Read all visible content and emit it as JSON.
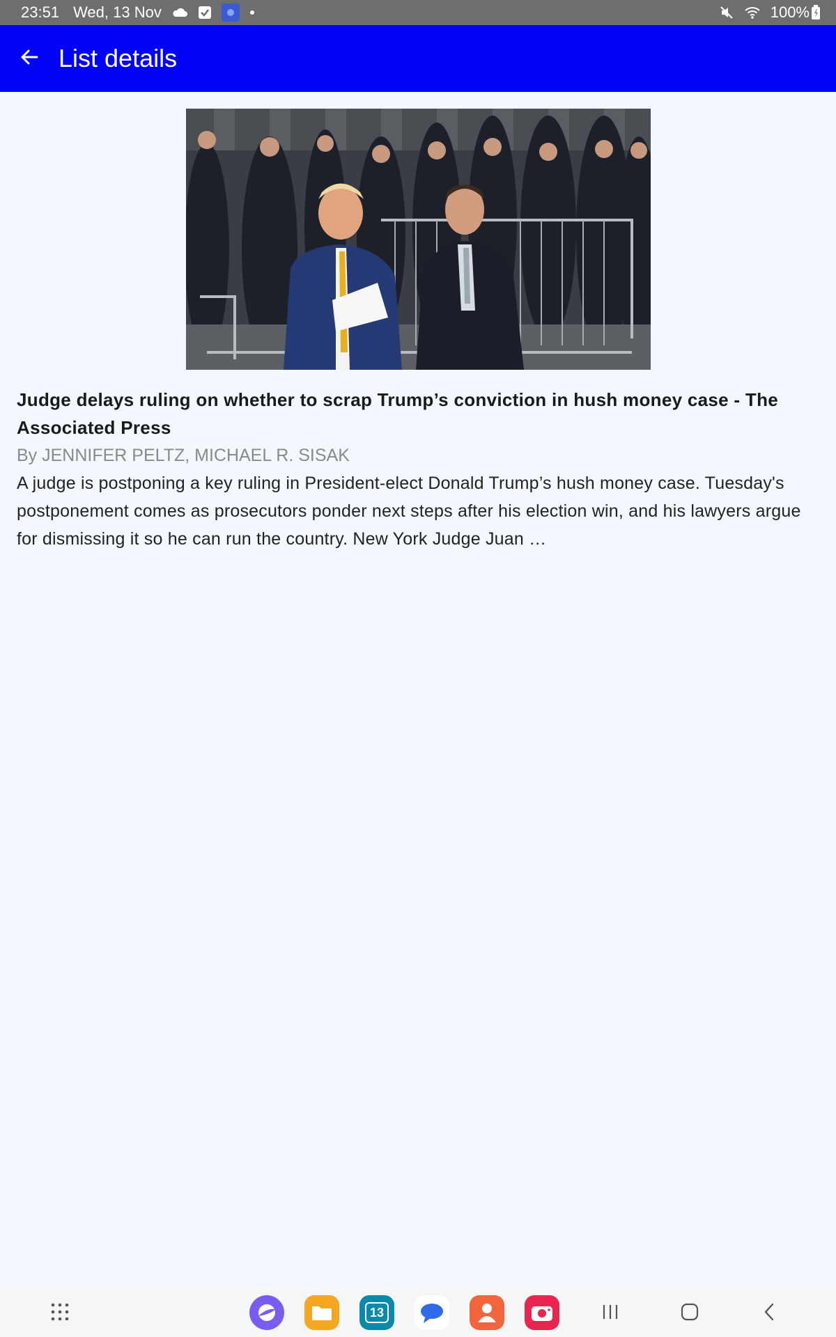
{
  "status_bar": {
    "time": "23:51",
    "date": "Wed, 13 Nov",
    "battery": "100%",
    "icons_left": [
      "cloud-icon",
      "check-box-icon",
      "app-notification-icon",
      "dot-icon"
    ],
    "icons_right": [
      "mute-icon",
      "wifi-icon",
      "battery-icon"
    ]
  },
  "app_bar": {
    "title": "List details",
    "back_icon": "arrow-back-icon",
    "background": "#0202f6"
  },
  "article": {
    "image_alt": "press photo",
    "headline": "Judge delays ruling on whether to scrap Trump’s conviction in hush money case - The Associated Press",
    "byline": "By JENNIFER PELTZ, MICHAEL R. SISAK",
    "description": "A judge is postponing a key ruling in President-elect Donald Trump’s hush money case. Tuesday's postponement comes as prosecutors ponder next steps after his election win, and his lawyers argue for dismissing it so he can run the country. New York Judge Juan …"
  },
  "nav_bar": {
    "apps_icon": "app-drawer-icon",
    "dock": [
      {
        "name": "internet-icon",
        "color": "#7a5cf0"
      },
      {
        "name": "files-icon",
        "color": "#f5a623"
      },
      {
        "name": "calendar-icon",
        "color": "#0a8aa8",
        "label": "13"
      },
      {
        "name": "messages-icon",
        "color": "#2f6be8"
      },
      {
        "name": "contacts-icon",
        "color": "#f2643c"
      },
      {
        "name": "camera-icon",
        "color": "#e8264f"
      }
    ],
    "keys": [
      "recents-icon",
      "home-icon",
      "back-nav-icon"
    ]
  }
}
